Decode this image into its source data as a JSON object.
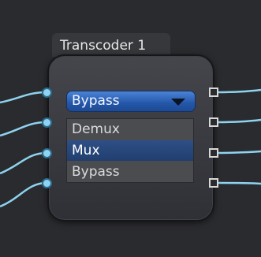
{
  "node": {
    "title": "Transcoder 1"
  },
  "dropdown": {
    "selected_value": "Bypass",
    "arrow_icon": "chevron-down-icon",
    "accent_color": "#2f64bd"
  },
  "menu": {
    "options": [
      "Demux",
      "Mux",
      "Bypass"
    ],
    "highlighted_option": "Mux"
  },
  "ports": {
    "inputs_count": 4,
    "outputs_count": 4,
    "input_color": "#8fd3f0",
    "output_color": "#d8d8d8"
  }
}
